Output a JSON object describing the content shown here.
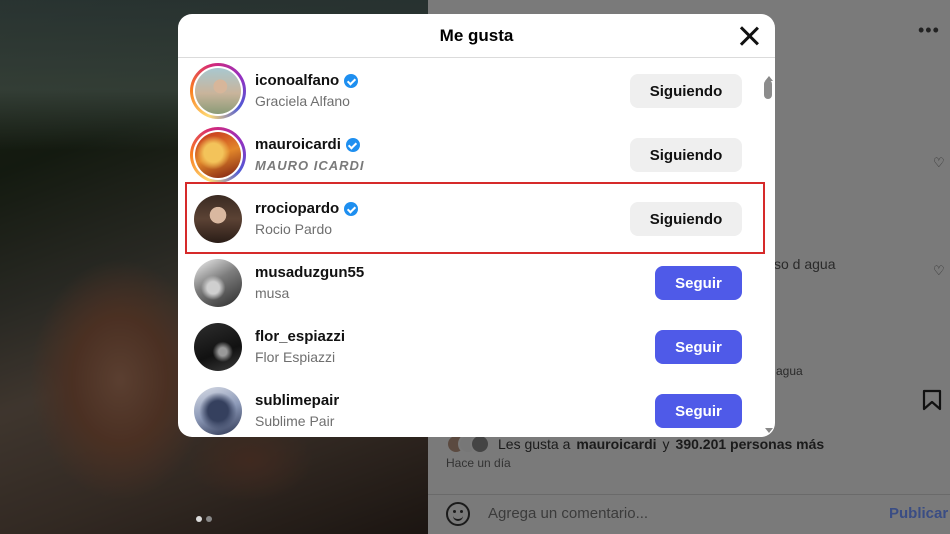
{
  "modal": {
    "title": "Me gusta",
    "close_icon": "close-icon",
    "rows": [
      {
        "username": "iconoalfano",
        "full_name": "Graciela Alfano",
        "verified": true,
        "button": "Siguiendo",
        "story_ring": true
      },
      {
        "username": "mauroicardi",
        "full_name": "MAURO ICARDI",
        "verified": true,
        "button": "Siguiendo",
        "story_ring": true
      },
      {
        "username": "rrociopardo",
        "full_name": "Rocio Pardo",
        "verified": true,
        "button": "Siguiendo",
        "story_ring": false,
        "highlighted": true
      },
      {
        "username": "musaduzgun55",
        "full_name": "musa",
        "verified": false,
        "button": "Seguir",
        "story_ring": false
      },
      {
        "username": "flor_espiazzi",
        "full_name": "Flor Espiazzi",
        "verified": false,
        "button": "Seguir",
        "story_ring": false
      },
      {
        "username": "sublimepair",
        "full_name": "Sublime Pair",
        "verified": false,
        "button": "Seguir",
        "story_ring": false
      }
    ],
    "colors": {
      "follow_button": "#4f5ae8",
      "following_button": "#efefef",
      "verified": "#1e8ff0",
      "highlight": "#d62a2a"
    }
  },
  "background": {
    "comment_snippet_1": "so d agua",
    "comment_snippet_2": "agua",
    "likes_prefix": "Les gusta a",
    "likes_user": "mauroicardi",
    "likes_connector": "y",
    "likes_count": "390.201 personas más",
    "time_ago": "Hace un día",
    "comment_placeholder": "Agrega un comentario...",
    "publish_label": "Publicar",
    "icons": [
      "more-icon",
      "heart-icon",
      "bookmark-icon",
      "emoji-icon"
    ]
  }
}
